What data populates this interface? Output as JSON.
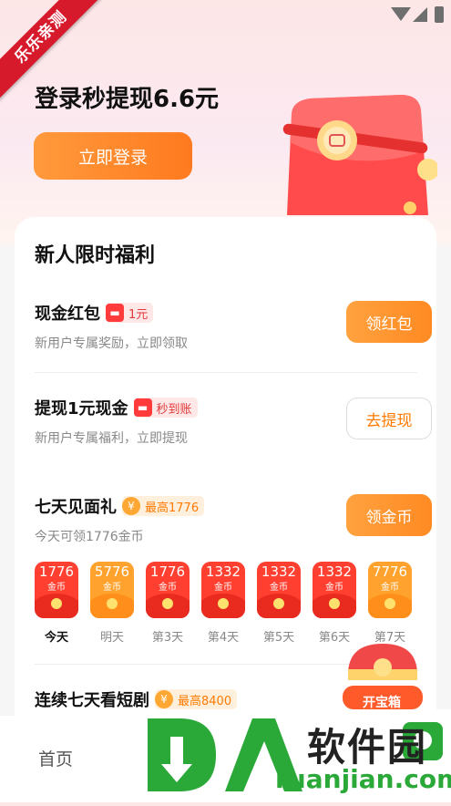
{
  "ribbon": {
    "text": "乐乐亲测"
  },
  "hero": {
    "title": "登录秒提现6.6元",
    "login_label": "立即登录"
  },
  "card": {
    "title": "新人限时福利"
  },
  "tasks": [
    {
      "title": "现金红包",
      "tag": "1元",
      "subtitle": "新用户专属奖励，立即领取",
      "button": "领红包"
    },
    {
      "title": "提现1元现金",
      "tag": "秒到账",
      "subtitle": "新用户专属福利，立即提现",
      "button": "去提现"
    },
    {
      "title": "七天见面礼",
      "tag": "最高1776",
      "subtitle": "今天可领1776金币",
      "button": "领金币"
    },
    {
      "title": "连续七天看短剧",
      "tag": "最高8400"
    }
  ],
  "days": [
    {
      "amount": "1776",
      "unit": "金币",
      "label": "今天",
      "style": "red"
    },
    {
      "amount": "5776",
      "unit": "金币",
      "label": "明天",
      "style": "orange"
    },
    {
      "amount": "1776",
      "unit": "金币",
      "label": "第3天",
      "style": "red"
    },
    {
      "amount": "1332",
      "unit": "金币",
      "label": "第4天",
      "style": "red"
    },
    {
      "amount": "1332",
      "unit": "金币",
      "label": "第5天",
      "style": "red"
    },
    {
      "amount": "1332",
      "unit": "金币",
      "label": "第6天",
      "style": "red"
    },
    {
      "amount": "7776",
      "unit": "金币",
      "label": "第7天",
      "style": "orange"
    }
  ],
  "chest": {
    "label": "开宝箱"
  },
  "nav": {
    "home": "首页"
  },
  "watermark": {
    "brand": "软件园",
    "url": "ruanjian.com"
  },
  "colors": {
    "accent": "#ff8a22",
    "red": "#ff3f2f",
    "brand_green": "#2aa838"
  }
}
